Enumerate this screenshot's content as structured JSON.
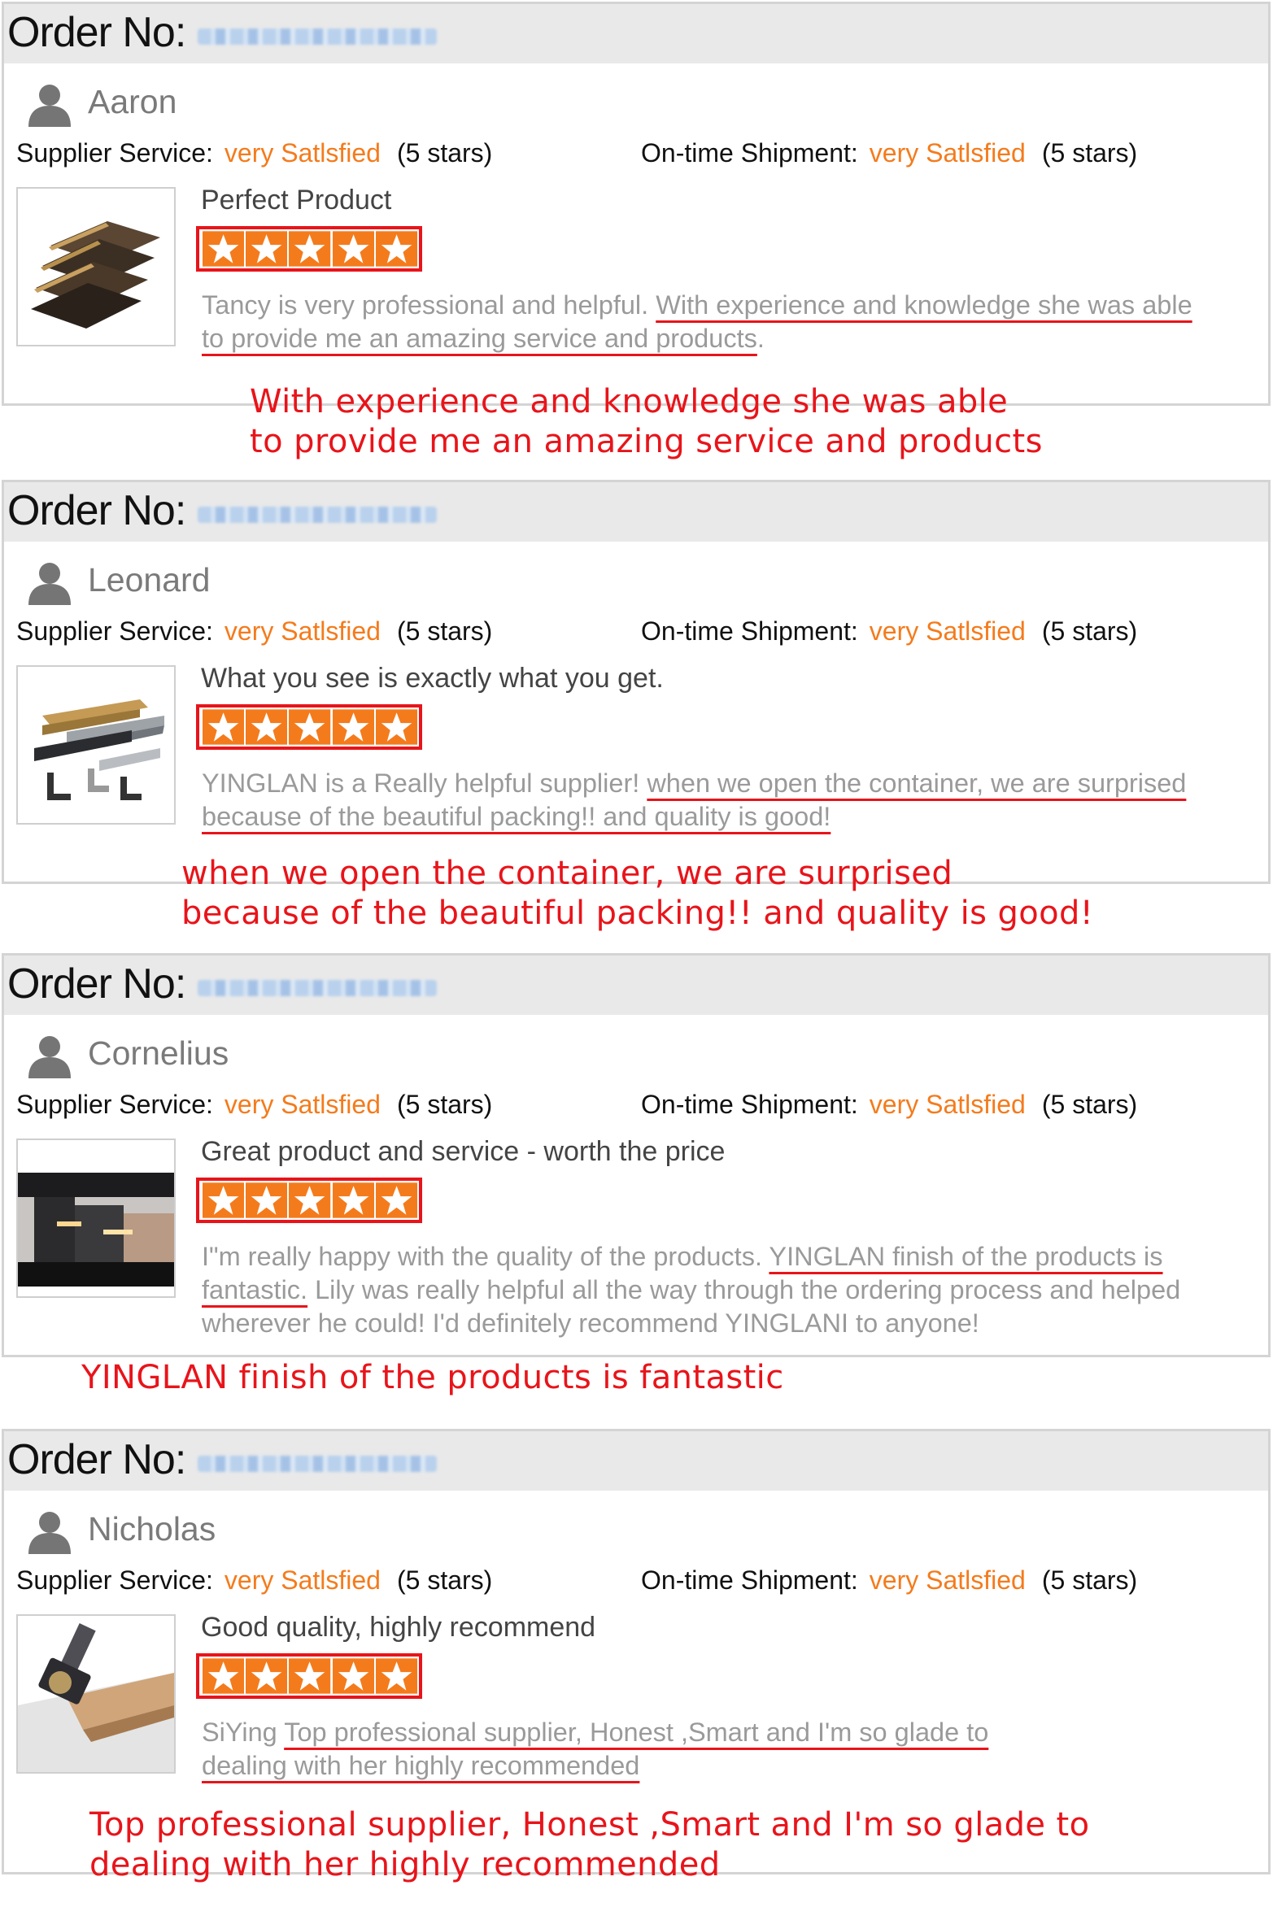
{
  "labels": {
    "order_no": "Order No:",
    "supplier_service": "Supplier Service:",
    "on_time_shipment": "On-time Shipment:",
    "satisfied": "very Satlsfied",
    "stars": "(5 stars)"
  },
  "colors": {
    "accent_orange": "#f47b1c",
    "highlight_red": "#e8141a",
    "header_gray": "#e9e9e9"
  },
  "reviews": [
    {
      "reviewer": "Aaron",
      "title": "Perfect Product",
      "rating": 5,
      "body": [
        {
          "pre": "Tancy is very professional and helpful. ",
          "hl": "With experience and knowledge she was able"
        },
        {
          "pre": "",
          "hl": "to provide me an amazing service and products",
          "post": "."
        }
      ],
      "highlight": [
        "With experience and knowledge she was able",
        "to provide me an amazing service and products"
      ]
    },
    {
      "reviewer": "Leonard",
      "title": "What you see is exactly what you get.",
      "rating": 5,
      "body": [
        {
          "pre": "YINGLAN is a Really helpful supplier!   ",
          "hl": "when we open the container, we are surprised"
        },
        {
          "pre": "",
          "hl": "because of the beautiful packing!! and quality is good!"
        }
      ],
      "highlight": [
        "when we open the container, we are surprised",
        "because of the beautiful packing!! and quality is good!"
      ]
    },
    {
      "reviewer": "Cornelius",
      "title": "Great product and service - worth the price",
      "rating": 5,
      "body": [
        {
          "pre": "I\"m really happy with the quality of the products. ",
          "hl": "YINGLAN finish of the products is"
        },
        {
          "pre": "",
          "hl": "fantastic.",
          "post": " Lily was really helpful all the way through the ordering process and helped"
        },
        {
          "pre": "wherever he could! I'd definitely recommend YINGLANI to anyone!"
        }
      ],
      "highlight": [
        "YINGLAN finish of the products is fantastic"
      ]
    },
    {
      "reviewer": "Nicholas",
      "title": "Good quality, highly recommend",
      "rating": 5,
      "body": [
        {
          "pre": "SiYing ",
          "hl": "Top professional supplier, Honest ,Smart and I'm so glade to"
        },
        {
          "pre": "",
          "hl": "dealing with her highly recommended"
        }
      ],
      "highlight": [
        "Top professional supplier, Honest ,Smart and I'm so glade to",
        "dealing with her highly recommended"
      ]
    }
  ]
}
